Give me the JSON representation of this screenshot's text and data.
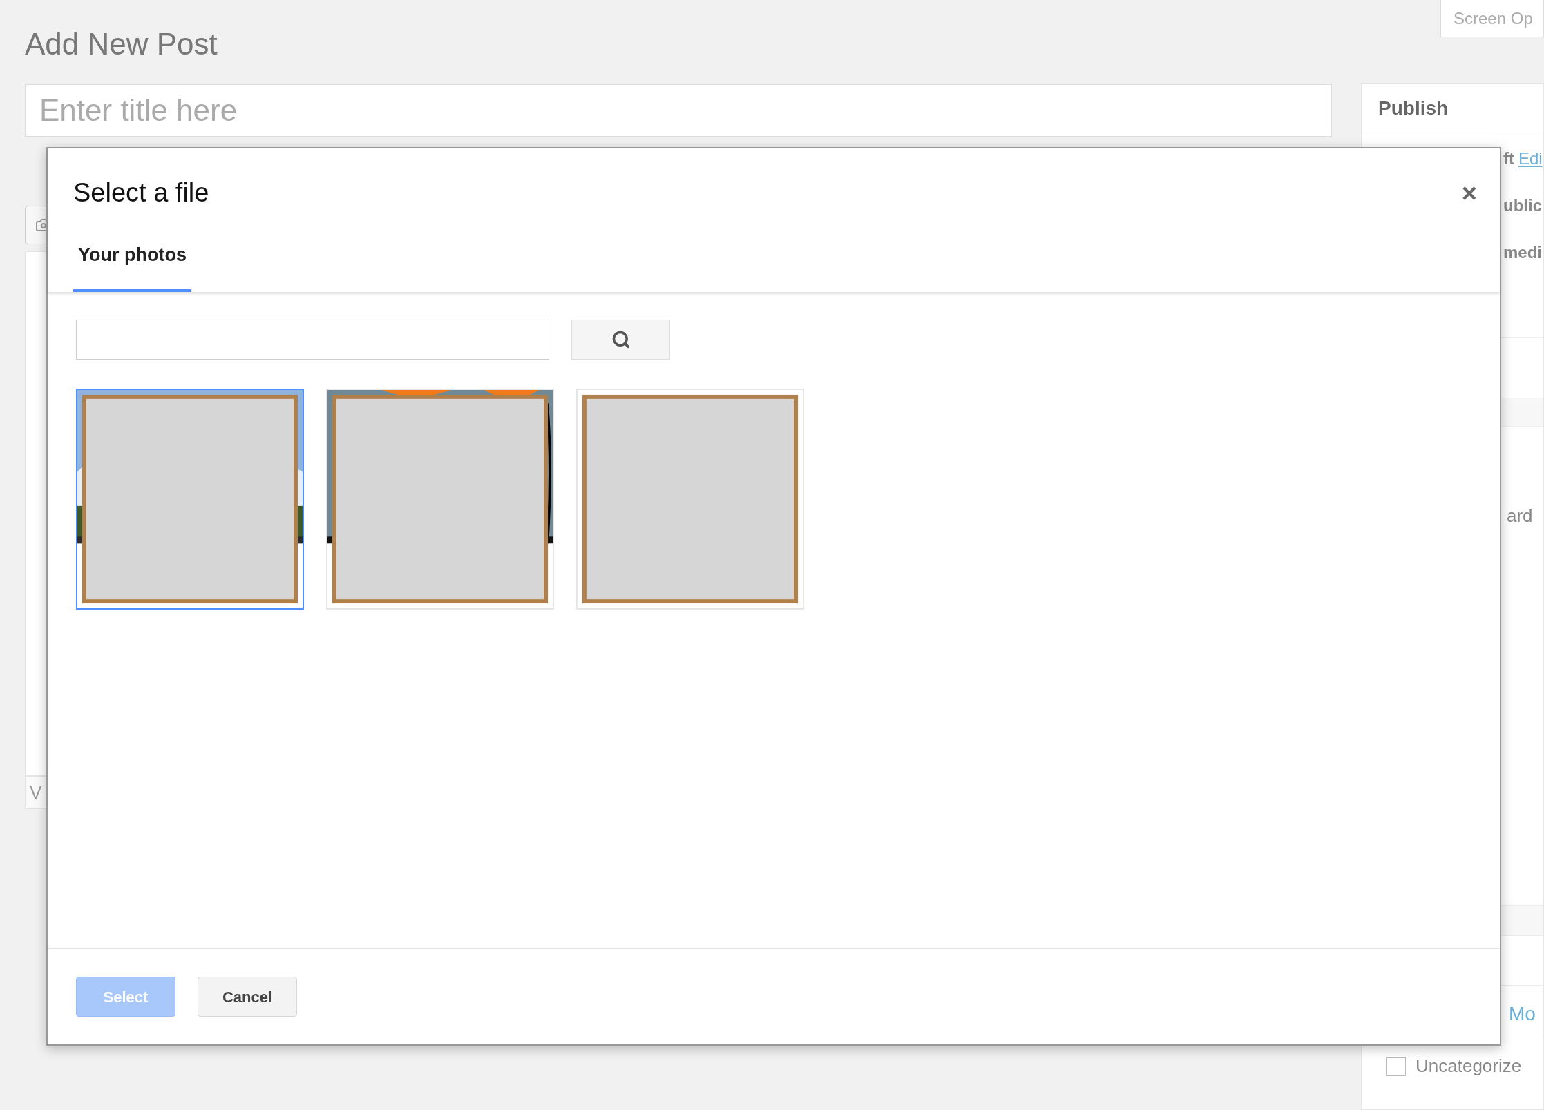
{
  "page": {
    "heading": "Add New Post",
    "screen_options": "Screen Op",
    "title_placeholder": "Enter title here",
    "editor_footer": "V"
  },
  "sidebar": {
    "publish_title": "Publish",
    "status_rows": [
      {
        "text": "ft",
        "link": "Edi"
      },
      {
        "text": "ublic"
      },
      {
        "text": "medi"
      }
    ],
    "other_rows": [
      "ard"
    ],
    "category_tab": "Mo",
    "category": {
      "label": "Uncategorize",
      "checked": false
    }
  },
  "dialog": {
    "title": "Select a file",
    "close": "×",
    "tabs": [
      {
        "label": "Your photos",
        "selected": true
      }
    ],
    "photos": [
      {
        "kind": "landscape",
        "selected": true
      },
      {
        "kind": "drawing",
        "selected": false
      },
      {
        "kind": "blank",
        "selected": false
      }
    ],
    "buttons": [
      {
        "label": "Select",
        "kind": "primary",
        "disabled": true
      },
      {
        "label": "Cancel",
        "kind": "secondary",
        "disabled": false
      }
    ]
  }
}
